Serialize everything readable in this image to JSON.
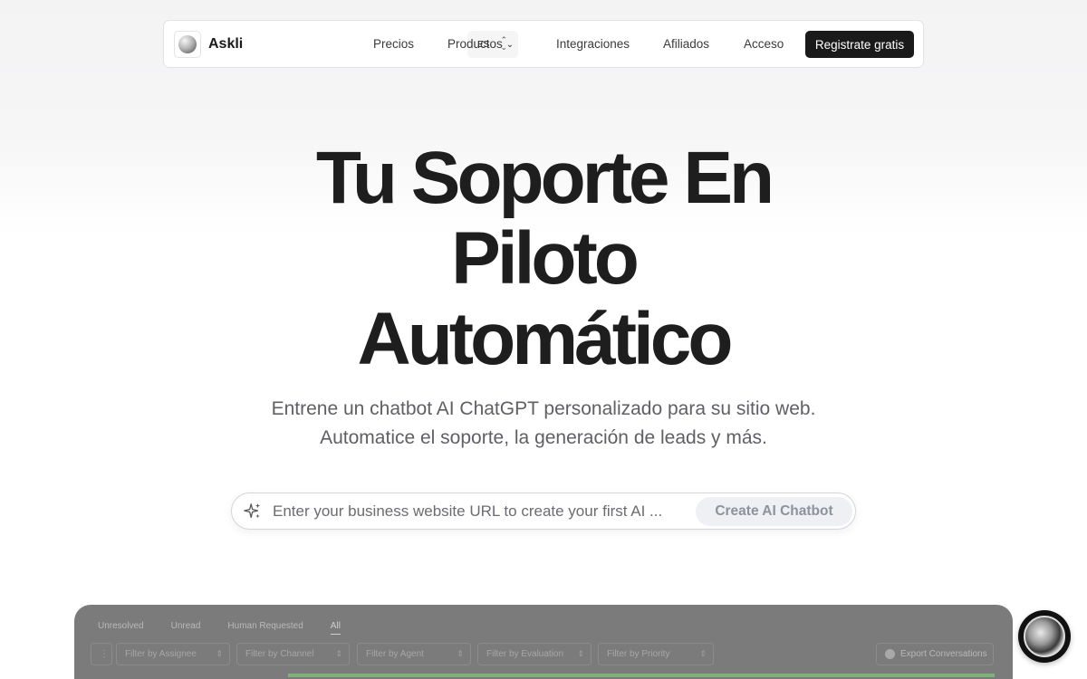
{
  "nav": {
    "brand": "Askli",
    "language": "ES",
    "links": {
      "pricing": "Precios",
      "products": "Productos",
      "integrations": "Integraciones",
      "affiliates": "Afiliados",
      "login": "Acceso"
    },
    "cta": "Registrate gratis"
  },
  "hero": {
    "title_line1": "Tu Soporte En",
    "title_line2": "Piloto",
    "title_line3": "Automático",
    "subtitle": "Entrene un chatbot AI ChatGPT personalizado para su sitio web. Automatice el soporte, la generación de leads y más."
  },
  "url_form": {
    "placeholder": "Enter your business website URL to create your first AI ...",
    "button": "Create AI Chatbot"
  },
  "preview": {
    "tabs": [
      "Unresolved",
      "Unread",
      "Human Requested",
      "All"
    ],
    "filters": [
      "Filter by Assignee",
      "Filter by Channel",
      "Filter by Agent",
      "Filter by Evaluation",
      "Filter by Priority"
    ],
    "export": "Export Conversations"
  },
  "icons": {
    "sparkle": "sparkle-icon",
    "chevron": "chevron-down-icon",
    "updown": "chevron-updown-icon",
    "chat": "chat-avatar-icon"
  },
  "colors": {
    "cta_bg": "#1a1a1a",
    "title": "#1e1e1e",
    "subtitle": "#5f5f66",
    "create_btn_text": "#8d929b",
    "preview_bg": "#7b7b7b",
    "preview_accent": "#7fb07d"
  }
}
